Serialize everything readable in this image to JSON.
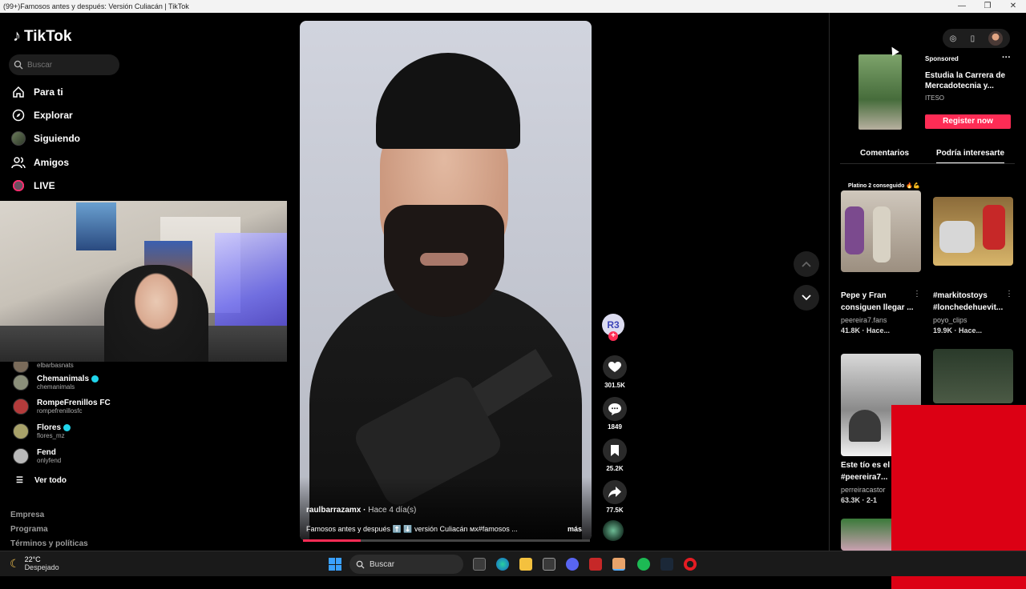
{
  "window": {
    "title": "(99+)Famosos antes y después: Versión Culiacán | TikTok",
    "controls": [
      "—",
      "❐",
      "✕"
    ]
  },
  "sidebar": {
    "logo": "TikTok",
    "search_placeholder": "Buscar",
    "nav": [
      {
        "label": "Para ti",
        "icon": "home-icon"
      },
      {
        "label": "Explorar",
        "icon": "compass-icon"
      },
      {
        "label": "Siguiendo",
        "icon": "following-avatar-icon"
      },
      {
        "label": "Amigos",
        "icon": "friends-icon"
      },
      {
        "label": "LIVE",
        "icon": "live-icon"
      }
    ],
    "following": [
      {
        "name": "",
        "username": "elbarbasnats",
        "verified": false
      },
      {
        "name": "Chemanimals",
        "username": "chemanimals",
        "verified": true
      },
      {
        "name": "RompeFrenillos FC",
        "username": "rompefrenillosfc",
        "verified": false
      },
      {
        "name": "Flores",
        "username": "flores_mz",
        "verified": true
      },
      {
        "name": "Fend",
        "username": "onlyfend",
        "verified": false
      }
    ],
    "see_all": "Ver todo",
    "footer_links": [
      "Empresa",
      "Programa",
      "Términos y políticas"
    ]
  },
  "video": {
    "author": "raulbarrazamx",
    "time": "Hace 4 día(s)",
    "caption": "Famosos antes y después ⬆️ ⬇️ versión Culiacán ᴍx#famosos ...",
    "more": "más",
    "progress": 0.2,
    "creator_initials": "R3",
    "actions": [
      {
        "name": "like",
        "count": "301.5K",
        "icon": "heart-icon"
      },
      {
        "name": "comment",
        "count": "1849",
        "icon": "comment-icon"
      },
      {
        "name": "save",
        "count": "25.2K",
        "icon": "bookmark-icon"
      },
      {
        "name": "share",
        "count": "77.5K",
        "icon": "share-icon"
      }
    ]
  },
  "right": {
    "ad": {
      "sponsored": "Sponsored",
      "title": "Estudia la Carrera de Mercadotecnia y...",
      "brand": "ITESO",
      "cta": "Register now"
    },
    "tabs": [
      "Comentarios",
      "Podría interesarte"
    ],
    "active_tab": "Podría interesarte",
    "recommendations": [
      {
        "overlay": "Platino 2 conseguido 🔥💪",
        "title": "Pepe y Fran consiguen llegar ...",
        "author": "peereira7.fans",
        "meta": "41.8K · Hace..."
      },
      {
        "overlay": "",
        "title": "#markitostoys #lonchedehuevit...",
        "author": "poyo_clips",
        "meta": "19.9K · Hace..."
      },
      {
        "overlay": "",
        "title": "Este tío es el #peereira7...",
        "author": "perreiracastor",
        "meta": "63.3K · 2-1"
      },
      {
        "overlay": "",
        "title": "",
        "author": "",
        "meta": ""
      }
    ]
  },
  "taskbar": {
    "temperature": "22°C",
    "weather": "Despejado",
    "search": "Buscar"
  },
  "colors": {
    "accent": "#fe2c55",
    "verified": "#20d5ec",
    "background": "#000000"
  }
}
